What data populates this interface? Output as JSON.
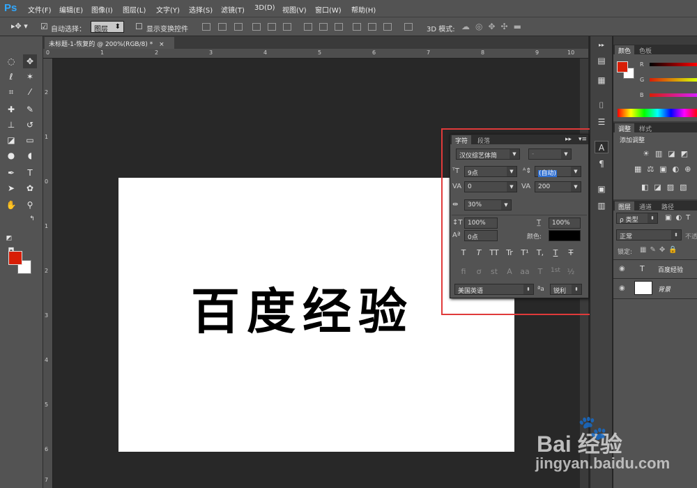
{
  "app": {
    "logo": "Ps"
  },
  "menus": [
    "文件(F)",
    "编辑(E)",
    "图像(I)",
    "图层(L)",
    "文字(Y)",
    "选择(S)",
    "滤镜(T)",
    "3D(D)",
    "视图(V)",
    "窗口(W)",
    "帮助(H)"
  ],
  "options_bar": {
    "tool_icon": "move-tool-icon",
    "auto_select_label": "自动选择：",
    "auto_select_checked": true,
    "auto_select_value": "图层",
    "show_transform_label": "显示变换控件",
    "show_transform_checked": false,
    "mode_3d_label": "3D 模式:"
  },
  "document": {
    "tab_title": "未标题-1-恢复的 @ 200%(RGB/8) *",
    "close_symbol": "×",
    "canvas_text": "百度经验",
    "ruler_top": [
      "1",
      "2",
      "3",
      "4",
      "5",
      "6",
      "7",
      "8",
      "9",
      "10"
    ],
    "ruler_left": [
      "2",
      "1",
      "0",
      "1",
      "2",
      "3",
      "4",
      "5",
      "6",
      "7"
    ]
  },
  "toolbox": {
    "foreground_color": "#d81e06",
    "background_color": "#ffffff",
    "tools": [
      "rectangle-marquee-icon",
      "move-icon",
      "lasso-icon",
      "magic-wand-icon",
      "crop-icon",
      "eyedropper-icon",
      "healing-brush-icon",
      "brush-icon",
      "clone-stamp-icon",
      "history-brush-icon",
      "eraser-icon",
      "gradient-icon",
      "blur-icon",
      "dodge-icon",
      "pen-icon",
      "type-icon",
      "path-select-icon",
      "shape-icon",
      "hand-icon",
      "zoom-icon"
    ]
  },
  "character_panel": {
    "tabs": [
      "字符",
      "段落"
    ],
    "font_family": "汉仪综艺体简",
    "font_style": "-",
    "font_size": "9点",
    "leading": "(自动)",
    "kerning": "0",
    "tracking": "200",
    "vertical_scale_pct": "30%",
    "tsume": "100%",
    "horizontal_scale": "100%",
    "baseline_shift": "0点",
    "color_label": "颜色:",
    "color_value": "#000000",
    "style_buttons": [
      "T",
      "T",
      "TT",
      "Tr",
      "T¹",
      "T,",
      "T",
      "T"
    ],
    "opentype_buttons": [
      "fi",
      "ơ",
      "st",
      "A",
      "aa",
      "T",
      "1st",
      "½"
    ],
    "language": "美国英语",
    "aa_label": "ªa",
    "antialias": "锐利"
  },
  "color_panel": {
    "tabs": [
      "颜色",
      "色板"
    ],
    "channels": [
      "R",
      "G",
      "B"
    ]
  },
  "adjustments_panel": {
    "tabs": [
      "调整",
      "样式"
    ],
    "add_label": "添加调整"
  },
  "layers_panel": {
    "tabs": [
      "图层",
      "通道",
      "路径"
    ],
    "filter_label": "ρ 类型",
    "blend_mode": "正常",
    "opacity_label": "不透",
    "lock_label": "锁定:",
    "layers": [
      {
        "name": "百度经验",
        "kind": "T"
      },
      {
        "name": "背景",
        "kind": "bg"
      }
    ]
  },
  "watermark": {
    "brand": "Bai  经验",
    "url": "jingyan.baidu.com"
  }
}
